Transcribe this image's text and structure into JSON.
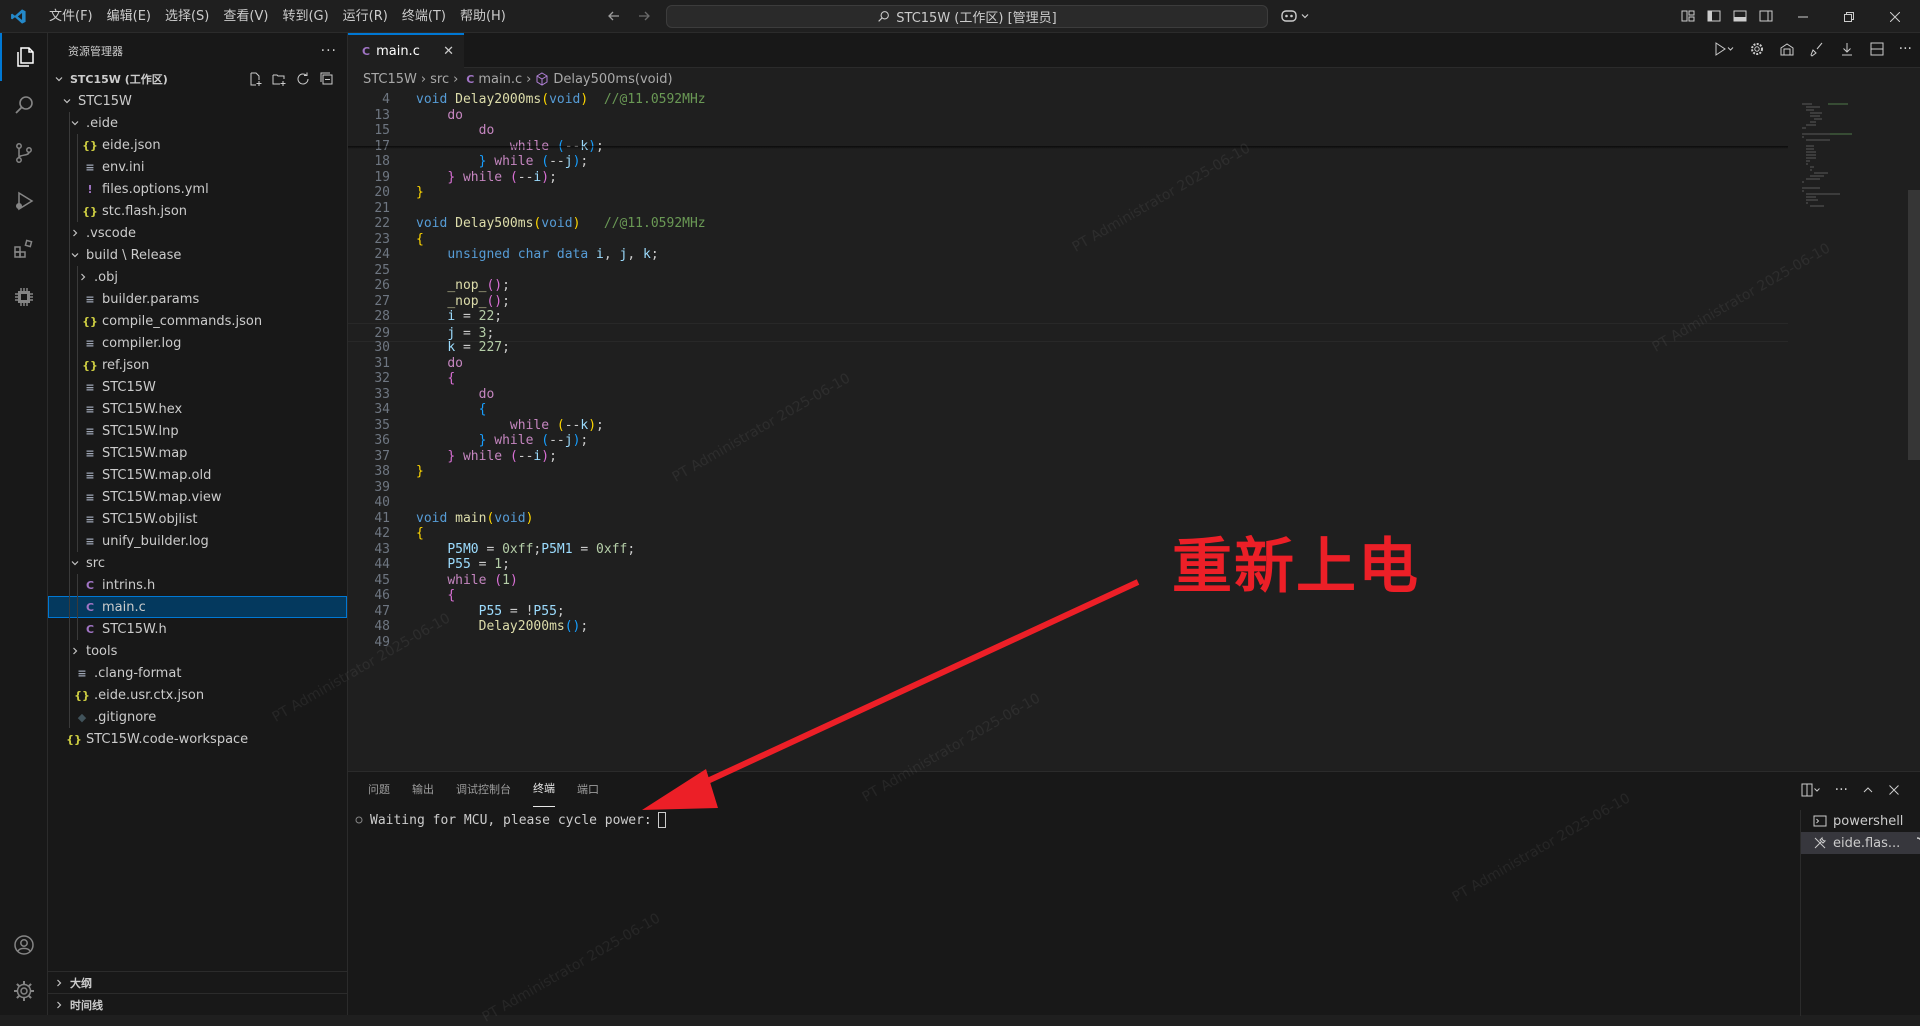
{
  "titlebar": {
    "menu": [
      "文件(F)",
      "编辑(E)",
      "选择(S)",
      "查看(V)",
      "转到(G)",
      "运行(R)",
      "终端(T)",
      "帮助(H)"
    ],
    "search_text": "STC15W (工作区) [管理员]"
  },
  "sidebar": {
    "title": "资源管理器",
    "workspace": "STC15W (工作区)",
    "tree": [
      {
        "label": "STC15W",
        "depth": 1,
        "type": "folder-open",
        "icon": ""
      },
      {
        "label": ".eide",
        "depth": 2,
        "type": "folder-open",
        "icon": ""
      },
      {
        "label": "eide.json",
        "depth": 3,
        "type": "file",
        "icon": "{}",
        "cls": "ic-json"
      },
      {
        "label": "env.ini",
        "depth": 3,
        "type": "file",
        "icon": "≡",
        "cls": "ic-txt"
      },
      {
        "label": "files.options.yml",
        "depth": 3,
        "type": "file",
        "icon": "!",
        "cls": "ic-yml"
      },
      {
        "label": "stc.flash.json",
        "depth": 3,
        "type": "file",
        "icon": "{}",
        "cls": "ic-json"
      },
      {
        "label": ".vscode",
        "depth": 2,
        "type": "folder",
        "icon": ""
      },
      {
        "label": "build \\ Release",
        "depth": 2,
        "type": "folder-open",
        "icon": ""
      },
      {
        "label": ".obj",
        "depth": 3,
        "type": "folder",
        "icon": ""
      },
      {
        "label": "builder.params",
        "depth": 3,
        "type": "file",
        "icon": "≡",
        "cls": "ic-txt"
      },
      {
        "label": "compile_commands.json",
        "depth": 3,
        "type": "file",
        "icon": "{}",
        "cls": "ic-json"
      },
      {
        "label": "compiler.log",
        "depth": 3,
        "type": "file",
        "icon": "≡",
        "cls": "ic-txt"
      },
      {
        "label": "ref.json",
        "depth": 3,
        "type": "file",
        "icon": "{}",
        "cls": "ic-json"
      },
      {
        "label": "STC15W",
        "depth": 3,
        "type": "file",
        "icon": "≡",
        "cls": "ic-txt"
      },
      {
        "label": "STC15W.hex",
        "depth": 3,
        "type": "file",
        "icon": "≡",
        "cls": "ic-txt"
      },
      {
        "label": "STC15W.lnp",
        "depth": 3,
        "type": "file",
        "icon": "≡",
        "cls": "ic-txt"
      },
      {
        "label": "STC15W.map",
        "depth": 3,
        "type": "file",
        "icon": "≡",
        "cls": "ic-txt"
      },
      {
        "label": "STC15W.map.old",
        "depth": 3,
        "type": "file",
        "icon": "≡",
        "cls": "ic-txt"
      },
      {
        "label": "STC15W.map.view",
        "depth": 3,
        "type": "file",
        "icon": "≡",
        "cls": "ic-txt"
      },
      {
        "label": "STC15W.objlist",
        "depth": 3,
        "type": "file",
        "icon": "≡",
        "cls": "ic-txt"
      },
      {
        "label": "unify_builder.log",
        "depth": 3,
        "type": "file",
        "icon": "≡",
        "cls": "ic-txt"
      },
      {
        "label": "src",
        "depth": 2,
        "type": "folder-open",
        "icon": ""
      },
      {
        "label": "intrins.h",
        "depth": 3,
        "type": "file",
        "icon": "C",
        "cls": "ic-c"
      },
      {
        "label": "main.c",
        "depth": 3,
        "type": "file",
        "icon": "C",
        "cls": "ic-c",
        "selected": true
      },
      {
        "label": "STC15W.h",
        "depth": 3,
        "type": "file",
        "icon": "C",
        "cls": "ic-c"
      },
      {
        "label": "tools",
        "depth": 2,
        "type": "folder",
        "icon": ""
      },
      {
        "label": ".clang-format",
        "depth": 2,
        "type": "file",
        "icon": "≡",
        "cls": "ic-txt"
      },
      {
        "label": ".eide.usr.ctx.json",
        "depth": 2,
        "type": "file",
        "icon": "{}",
        "cls": "ic-json"
      },
      {
        "label": ".gitignore",
        "depth": 2,
        "type": "file",
        "icon": "◆",
        "cls": "ic-git"
      },
      {
        "label": "STC15W.code-workspace",
        "depth": 1,
        "type": "file",
        "icon": "{}",
        "cls": "ic-json"
      }
    ],
    "outline": "大纲",
    "timeline": "时间线"
  },
  "editor": {
    "tab_label": "main.c",
    "breadcrumb": [
      "STC15W",
      "src",
      "main.c",
      "Delay500ms(void)"
    ]
  },
  "code_lines": [
    {
      "n": "4",
      "html": "<span class='kw'>void</span> <span class='fn'>Delay2000ms</span><span class='br1'>(</span><span class='kw'>void</span><span class='br1'>)</span>  <span class='cm'>//@11.0592MHz</span>"
    },
    {
      "n": "13",
      "html": "    <span class='kw2'>do</span>"
    },
    {
      "n": "15",
      "html": "        <span class='kw2'>do</span>"
    },
    {
      "n": "17",
      "html": "            <span class='kw2'>while</span> <span class='br3'>(</span>--<span class='var'>k</span><span class='br3'>)</span>;"
    },
    {
      "n": "18",
      "html": "        <span class='br3'>}</span> <span class='kw2'>while</span> <span class='br3'>(</span>--<span class='var'>j</span><span class='br3'>)</span>;"
    },
    {
      "n": "19",
      "html": "    <span class='br2'>}</span> <span class='kw2'>while</span> <span class='br2'>(</span>--<span class='var'>i</span><span class='br2'>)</span>;"
    },
    {
      "n": "20",
      "html": "<span class='br1'>}</span>"
    },
    {
      "n": "21",
      "html": ""
    },
    {
      "n": "22",
      "html": "<span class='kw'>void</span> <span class='fn'>Delay500ms</span><span class='br1'>(</span><span class='kw'>void</span><span class='br1'>)</span>   <span class='cm'>//@11.0592MHz</span>"
    },
    {
      "n": "23",
      "html": "<span class='br1'>{</span>"
    },
    {
      "n": "24",
      "html": "    <span class='kw'>unsigned</span> <span class='kw'>char</span> <span class='kw'>data</span> <span class='var'>i</span>, <span class='var'>j</span>, <span class='var'>k</span>;"
    },
    {
      "n": "25",
      "html": ""
    },
    {
      "n": "26",
      "html": "    <span class='fn'>_nop_</span><span class='br2'>()</span>;"
    },
    {
      "n": "27",
      "html": "    <span class='fn'>_nop_</span><span class='br2'>()</span>;"
    },
    {
      "n": "28",
      "html": "    <span class='var'>i</span> = <span class='num'>22</span>;"
    },
    {
      "n": "29",
      "html": "    <span class='var'>j</span> = <span class='num'>3</span>;",
      "cur": true
    },
    {
      "n": "30",
      "html": "    <span class='var'>k</span> = <span class='num'>227</span>;"
    },
    {
      "n": "31",
      "html": "    <span class='kw2'>do</span>"
    },
    {
      "n": "32",
      "html": "    <span class='br2'>{</span>"
    },
    {
      "n": "33",
      "html": "        <span class='kw2'>do</span>"
    },
    {
      "n": "34",
      "html": "        <span class='br3'>{</span>"
    },
    {
      "n": "35",
      "html": "            <span class='kw2'>while</span> <span class='br1'>(</span>--<span class='var'>k</span><span class='br1'>)</span>;"
    },
    {
      "n": "36",
      "html": "        <span class='br3'>}</span> <span class='kw2'>while</span> <span class='br3'>(</span>--<span class='var'>j</span><span class='br3'>)</span>;"
    },
    {
      "n": "37",
      "html": "    <span class='br2'>}</span> <span class='kw2'>while</span> <span class='br2'>(</span>--<span class='var'>i</span><span class='br2'>)</span>;"
    },
    {
      "n": "38",
      "html": "<span class='br1'>}</span>"
    },
    {
      "n": "39",
      "html": ""
    },
    {
      "n": "40",
      "html": ""
    },
    {
      "n": "41",
      "html": "<span class='kw'>void</span> <span class='fn'>main</span><span class='br1'>(</span><span class='kw'>void</span><span class='br1'>)</span>"
    },
    {
      "n": "42",
      "html": "<span class='br1'>{</span>"
    },
    {
      "n": "43",
      "html": "    <span class='var'>P5M0</span> = <span class='num'>0xff</span>;<span class='var'>P5M1</span> = <span class='num'>0xff</span>;"
    },
    {
      "n": "44",
      "html": "    <span class='var'>P55</span> = <span class='num'>1</span>;"
    },
    {
      "n": "45",
      "html": "    <span class='kw2'>while</span> <span class='br2'>(</span><span class='num'>1</span><span class='br2'>)</span>"
    },
    {
      "n": "46",
      "html": "    <span class='br2'>{</span>"
    },
    {
      "n": "47",
      "html": "        <span class='var'>P55</span> = !<span class='var'>P55</span>;"
    },
    {
      "n": "48",
      "html": "        <span class='fn'>Delay2000ms</span><span class='br3'>()</span>;"
    },
    {
      "n": "49",
      "html": ""
    }
  ],
  "panel": {
    "tabs": [
      "问题",
      "输出",
      "调试控制台",
      "终端",
      "端口"
    ],
    "active_tab": "终端",
    "terminal_text": "Waiting for MCU, please cycle power:",
    "terminals": [
      "powershell",
      "eide.flas..."
    ]
  },
  "annotation": {
    "text": "重新上电",
    "color": "#ec1f27"
  },
  "watermark": "PT Administrator 2025-06-10",
  "colors": {
    "accent": "#0078d4",
    "background": "#1f1f1f"
  }
}
